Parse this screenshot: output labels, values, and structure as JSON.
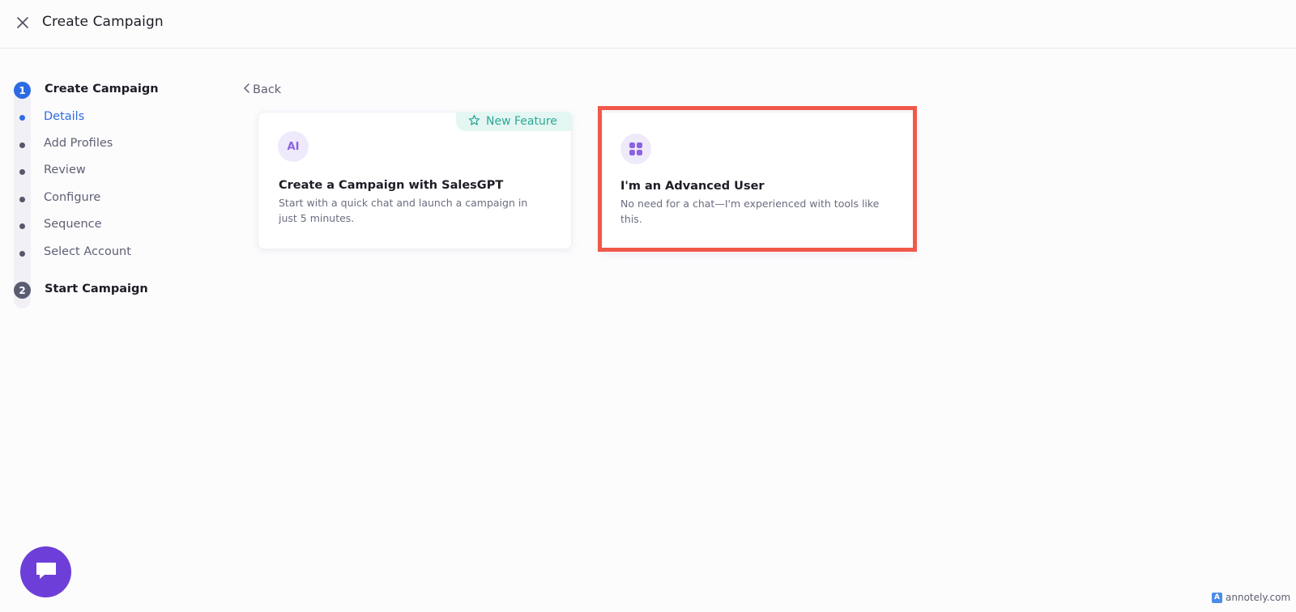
{
  "header": {
    "title": "Create Campaign",
    "close_icon": "close-icon"
  },
  "stepper": {
    "steps": [
      {
        "number": "1",
        "title": "Create Campaign",
        "state": "active",
        "substeps": [
          {
            "label": "Details",
            "active": true
          },
          {
            "label": "Add Profiles",
            "active": false
          },
          {
            "label": "Review",
            "active": false
          },
          {
            "label": "Configure",
            "active": false
          },
          {
            "label": "Sequence",
            "active": false
          },
          {
            "label": "Select Account",
            "active": false
          }
        ]
      },
      {
        "number": "2",
        "title": "Start Campaign",
        "state": "inactive"
      }
    ]
  },
  "back": {
    "label": "Back",
    "icon": "chevron-left-icon"
  },
  "cards": {
    "ai": {
      "badge": "New Feature",
      "badge_icon": "star-icon",
      "icon_text": "AI",
      "heading": "Create a Campaign with SalesGPT",
      "desc_line1": "Start with a quick chat and launch a campaign in",
      "desc_line2": "just 5 minutes."
    },
    "advanced": {
      "icon": "grid-icon",
      "heading": "I'm an Advanced User",
      "desc_line1": "No need for a chat—I'm experienced with tools like",
      "desc_line2": "this."
    }
  },
  "chat": {
    "icon": "chat-icon"
  },
  "watermark": {
    "text": "annotely.com"
  },
  "colors": {
    "primary": "#2d6be4",
    "highlight": "#f0594a",
    "accent_purple": "#6d3fd8",
    "badge_green": "#2ba896"
  }
}
